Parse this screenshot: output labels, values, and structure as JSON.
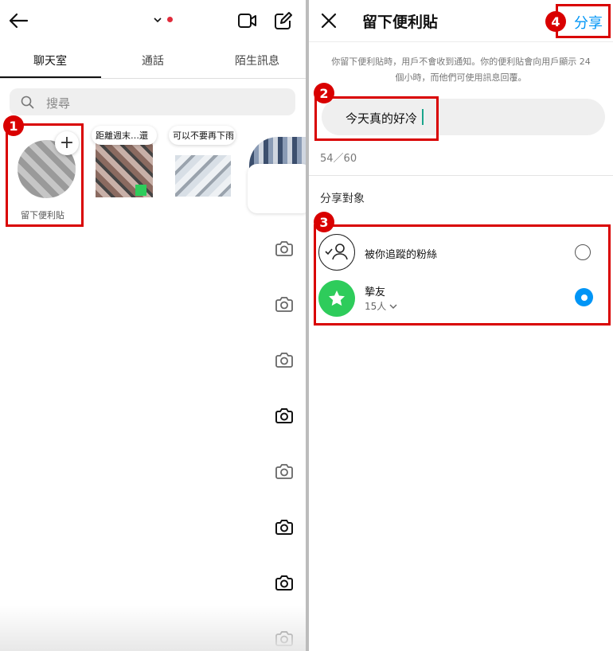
{
  "left": {
    "tabs": [
      {
        "label": "聊天室",
        "active": true
      },
      {
        "label": "通話",
        "active": false
      },
      {
        "label": "陌生訊息",
        "active": false
      }
    ],
    "search_placeholder": "搜尋",
    "notes": [
      {
        "label": "留下便利貼",
        "bubble": "+"
      },
      {
        "bubble": "距離週末…還"
      },
      {
        "bubble": "可以不要再下雨"
      }
    ],
    "camera_icon_count": 8
  },
  "right": {
    "title": "留下便利貼",
    "share_label": "分享",
    "info_text_line1": "你留下便利貼時，用戶不會收到通知。你的便利貼會向用戶顯示 24",
    "info_text_line2": "個小時，而他們可使用訊息回覆。",
    "note_text": "今天真的好冷",
    "counter": "54／60",
    "share_with_title": "分享對象",
    "options": [
      {
        "label": "被你追蹤的粉絲",
        "selected": false,
        "icon": "follow-back-icon"
      },
      {
        "label": "摯友",
        "sublabel": "15人",
        "selected": true,
        "icon": "star-icon"
      }
    ]
  },
  "annotations": {
    "badges": [
      "1",
      "2",
      "3",
      "4"
    ]
  },
  "colors": {
    "accent": "#0095f6",
    "highlight": "#d90000",
    "close_friends": "#2ecc5b"
  }
}
